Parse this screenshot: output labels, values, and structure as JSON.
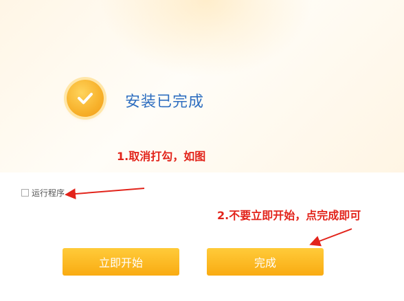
{
  "installer": {
    "status_title": "安装已完成",
    "run_option_label": "运行程序",
    "run_option_checked": false,
    "start_button_label": "立即开始",
    "finish_button_label": "完成"
  },
  "annotations": {
    "step1": "1.取消打勾，如图",
    "step2": "2.不要立即开始，点完成即可"
  },
  "colors": {
    "accent_button": "#f9ab12",
    "title_blue": "#2e6ec0",
    "annotation_red": "#e2231a"
  },
  "icons": {
    "status": "check-icon"
  }
}
